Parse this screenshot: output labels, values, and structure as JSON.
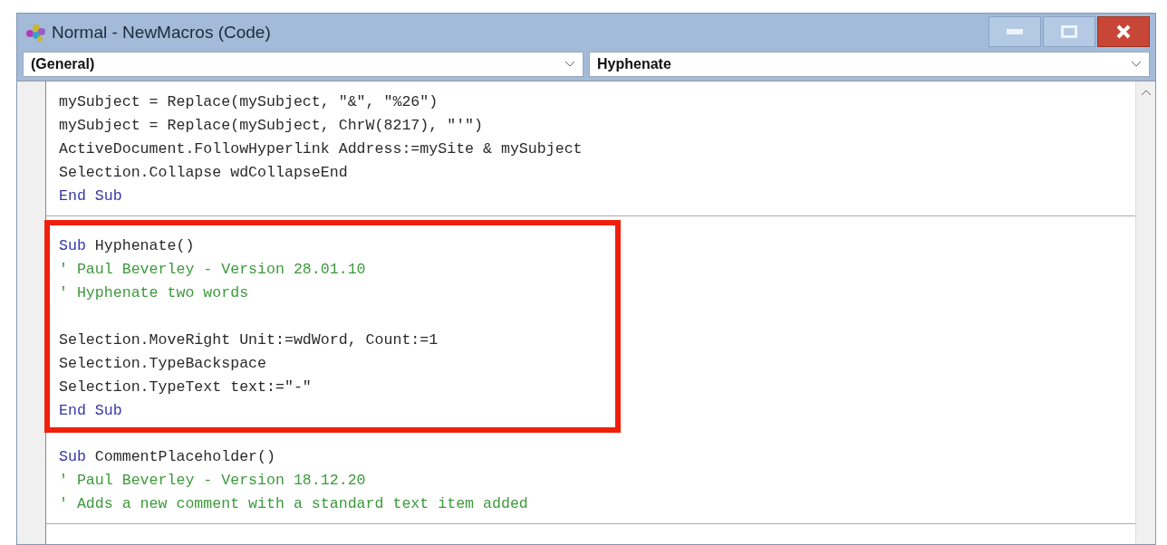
{
  "window": {
    "title": "Normal - NewMacros (Code)"
  },
  "object_dropdown": {
    "value": "(General)"
  },
  "procedure_dropdown": {
    "value": "Hyphenate"
  },
  "procedures": [
    {
      "highlighted": false,
      "lines": [
        [
          {
            "kind": "plain",
            "text": "mySubject = Replace(mySubject, \"&\", \"%26\")"
          }
        ],
        [
          {
            "kind": "plain",
            "text": "mySubject = Replace(mySubject, ChrW(8217), \"'\")"
          }
        ],
        [
          {
            "kind": "plain",
            "text": "ActiveDocument.FollowHyperlink Address:=mySite & mySubject"
          }
        ],
        [
          {
            "kind": "plain",
            "text": "Selection.Collapse wdCollapseEnd"
          }
        ],
        [
          {
            "kind": "keyword",
            "text": "End Sub"
          }
        ]
      ]
    },
    {
      "highlighted": true,
      "lines": [
        [
          {
            "kind": "keyword",
            "text": "Sub"
          },
          {
            "kind": "plain",
            "text": " Hyphenate()"
          }
        ],
        [
          {
            "kind": "comment",
            "text": "' Paul Beverley - Version 28.01.10"
          }
        ],
        [
          {
            "kind": "comment",
            "text": "' Hyphenate two words"
          }
        ],
        {
          "kind": "blank"
        },
        [
          {
            "kind": "plain",
            "text": "Selection.MoveRight Unit:=wdWord, Count:=1"
          }
        ],
        [
          {
            "kind": "plain",
            "text": "Selection.TypeBackspace"
          }
        ],
        [
          {
            "kind": "plain",
            "text": "Selection.TypeText text:=\"-\""
          }
        ],
        [
          {
            "kind": "keyword",
            "text": "End Sub"
          }
        ]
      ]
    },
    {
      "highlighted": false,
      "lines": [
        [
          {
            "kind": "keyword",
            "text": "Sub"
          },
          {
            "kind": "plain",
            "text": " CommentPlaceholder()"
          }
        ],
        [
          {
            "kind": "comment",
            "text": "' Paul Beverley - Version 18.12.20"
          }
        ],
        [
          {
            "kind": "comment",
            "text": "' Adds a new comment with a standard text item added"
          }
        ]
      ]
    }
  ]
}
